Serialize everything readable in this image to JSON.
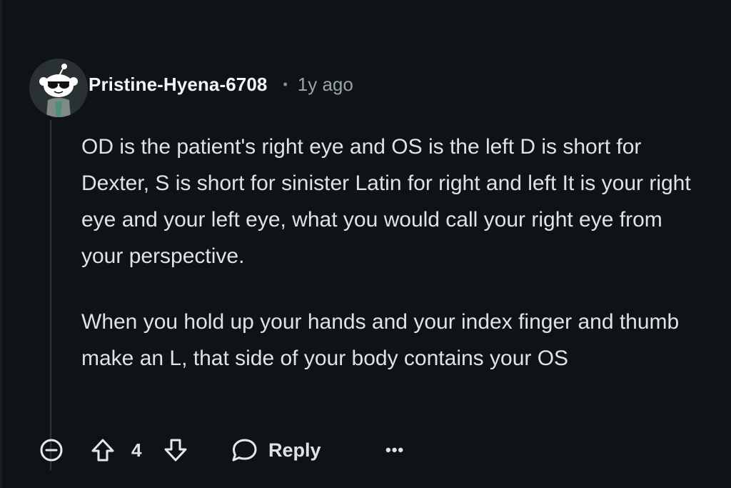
{
  "comment": {
    "username": "Pristine-Hyena-6708",
    "separator": "•",
    "timestamp": "1y ago",
    "paragraphs": [
      "OD is the patient's right eye and OS is the left D is short for Dexter, S is short for sinister Latin for right and left It is your right eye and your left eye, what you would call your right eye from your perspective.",
      "When you hold up your hands and your index finger and thumb make an L, that side of your body contains your OS"
    ]
  },
  "actions": {
    "collapse_icon": "minus-circle-icon",
    "upvote_icon": "arrow-up-outline-icon",
    "score": "4",
    "downvote_icon": "arrow-down-outline-icon",
    "reply_icon": "speech-bubble-icon",
    "reply_label": "Reply",
    "more_label": "•••"
  },
  "colors": {
    "background": "#0e1416",
    "text": "#dfe3e5",
    "muted": "#9aa4a6",
    "thread_line": "#2f3537"
  }
}
